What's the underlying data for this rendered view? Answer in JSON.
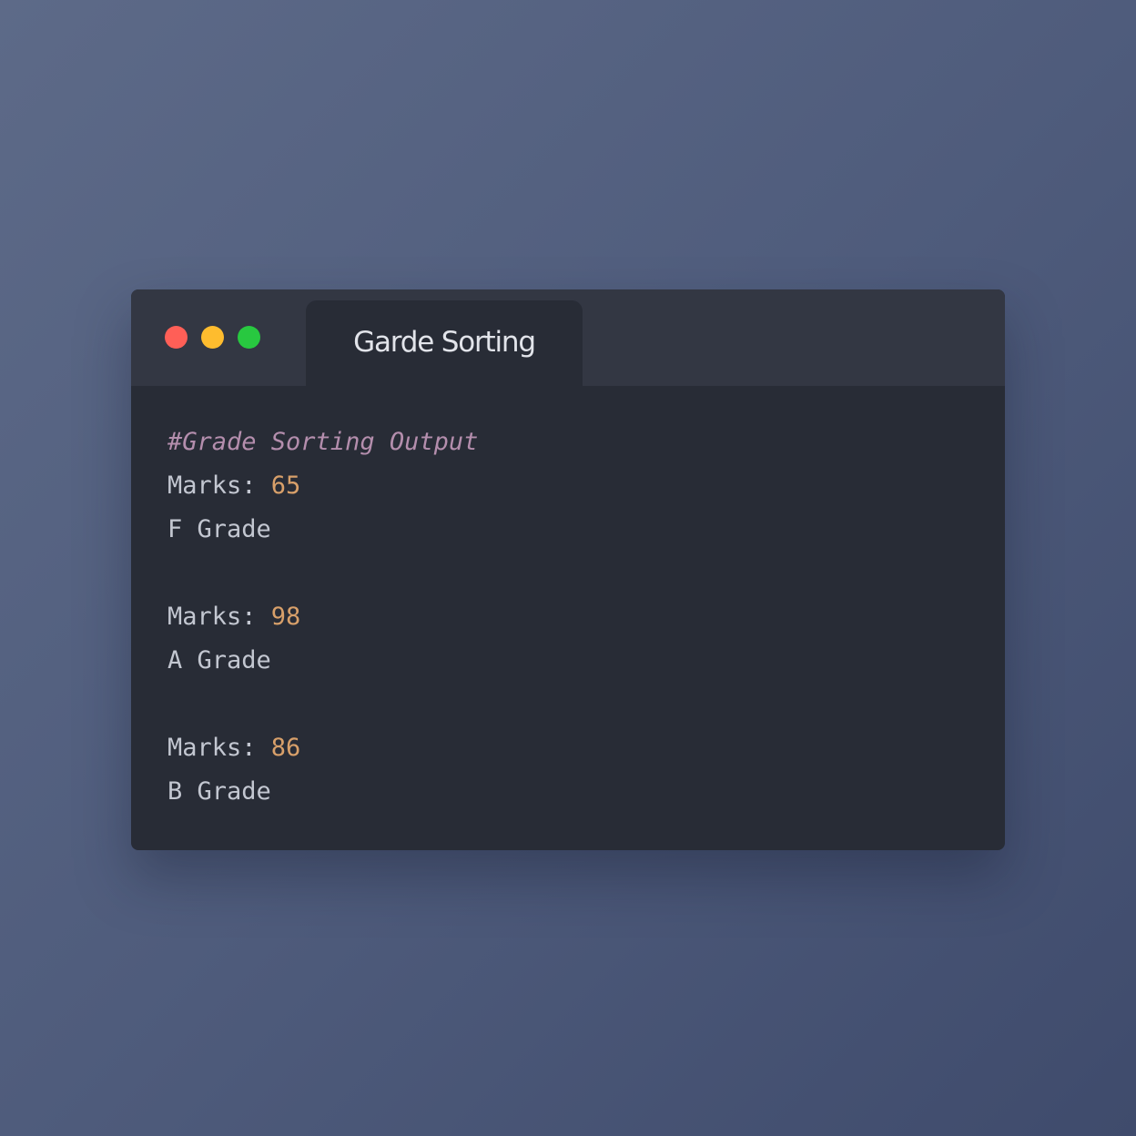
{
  "window": {
    "tab_title": "Garde Sorting",
    "traffic_lights": {
      "close_color": "#ff5f57",
      "minimize_color": "#febc2e",
      "maximize_color": "#28c840"
    }
  },
  "colors": {
    "comment": "#b48ead",
    "number": "#d8a06a",
    "text": "#c3c7d1"
  },
  "code": {
    "comment": "#Grade Sorting Output",
    "entries": [
      {
        "marks_label": "Marks: ",
        "marks_value": "65",
        "grade": "F Grade"
      },
      {
        "marks_label": "Marks: ",
        "marks_value": "98",
        "grade": "A Grade"
      },
      {
        "marks_label": "Marks: ",
        "marks_value": "86",
        "grade": "B Grade"
      }
    ]
  }
}
